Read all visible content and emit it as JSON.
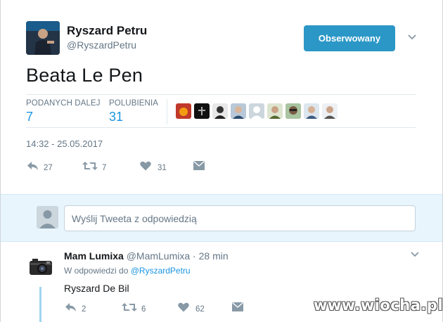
{
  "tweet": {
    "author_name": "Ryszard Petru",
    "author_handle": "@RyszardPetru",
    "follow_label": "Obserwowany",
    "text": "Beata Le Pen",
    "stats": {
      "retweets_label": "PODANYCH DALEJ",
      "retweets_value": "7",
      "likes_label": "POLUBIENIA",
      "likes_value": "31"
    },
    "timestamp": "14:32 - 25.05.2017",
    "actions": {
      "reply_count": "27",
      "retweet_count": "7",
      "like_count": "31"
    }
  },
  "composer": {
    "placeholder": "Wyślij Tweeta z odpowiedzią"
  },
  "reply": {
    "author_name": "Mam Lumixa",
    "author_handle": "@MamLumixa",
    "separator": "·",
    "time": "28 min",
    "context_prefix": "W odpowiedzi do",
    "context_link": "@RyszardPetru",
    "text": "Ryszard De Bil",
    "actions": {
      "reply_count": "2",
      "retweet_count": "6",
      "like_count": "62"
    }
  },
  "watermark": "www.wiocha.pl",
  "colors": {
    "accent": "#1b95e0",
    "follow_button": "#2b97c7",
    "reply_area_bg": "#e8f5fd",
    "muted": "#657786"
  }
}
